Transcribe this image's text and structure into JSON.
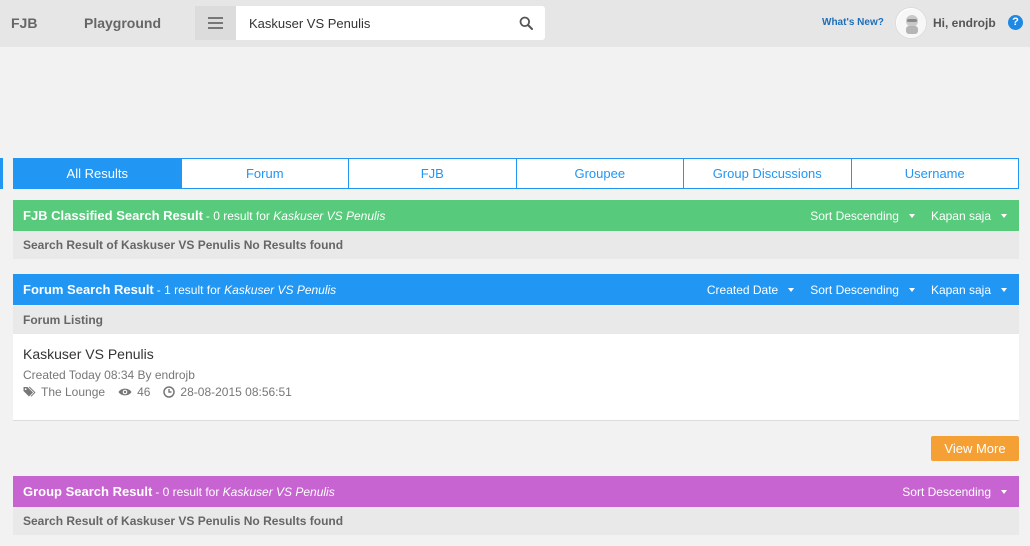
{
  "header": {
    "brand_fjb": "FJB",
    "brand_playground": "Playground",
    "search_value": "Kaskuser VS Penulis",
    "whats_new": "What's New?",
    "greeting": "Hi, endrojb",
    "help_label": "?"
  },
  "tabs": [
    {
      "label": "All Results",
      "active": true
    },
    {
      "label": "Forum",
      "active": false
    },
    {
      "label": "FJB",
      "active": false
    },
    {
      "label": "Groupee",
      "active": false
    },
    {
      "label": "Group Discussions",
      "active": false
    },
    {
      "label": "Username",
      "active": false
    }
  ],
  "fjb_section": {
    "title": "FJB Classified Search Result",
    "meta_prefix": "- 0 result for ",
    "query": "Kaskuser VS Penulis",
    "sort": "Sort Descending",
    "time": "Kapan saja",
    "no_results": "Search Result of Kaskuser VS Penulis No Results found"
  },
  "forum_section": {
    "title": "Forum Search Result",
    "meta_prefix": "- 1 result for ",
    "query": "Kaskuser VS Penulis",
    "created_date": "Created Date",
    "sort": "Sort Descending",
    "time": "Kapan saja",
    "listing_label": "Forum Listing",
    "result": {
      "title": "Kaskuser VS Penulis",
      "created": "Created Today 08:34 By endrojb",
      "forum": "The Lounge",
      "views": "46",
      "timestamp": "28-08-2015 08:56:51"
    },
    "view_more": "View More"
  },
  "group_section": {
    "title": "Group Search Result",
    "meta_prefix": "- 0 result for ",
    "query": "Kaskuser VS Penulis",
    "sort": "Sort Descending",
    "no_results": "Search Result of Kaskuser VS Penulis No Results found"
  },
  "colors": {
    "accent_blue": "#2196f3",
    "fjb_green": "#57ca7c",
    "group_purple": "#c764d1",
    "view_more_orange": "#f5a035"
  }
}
